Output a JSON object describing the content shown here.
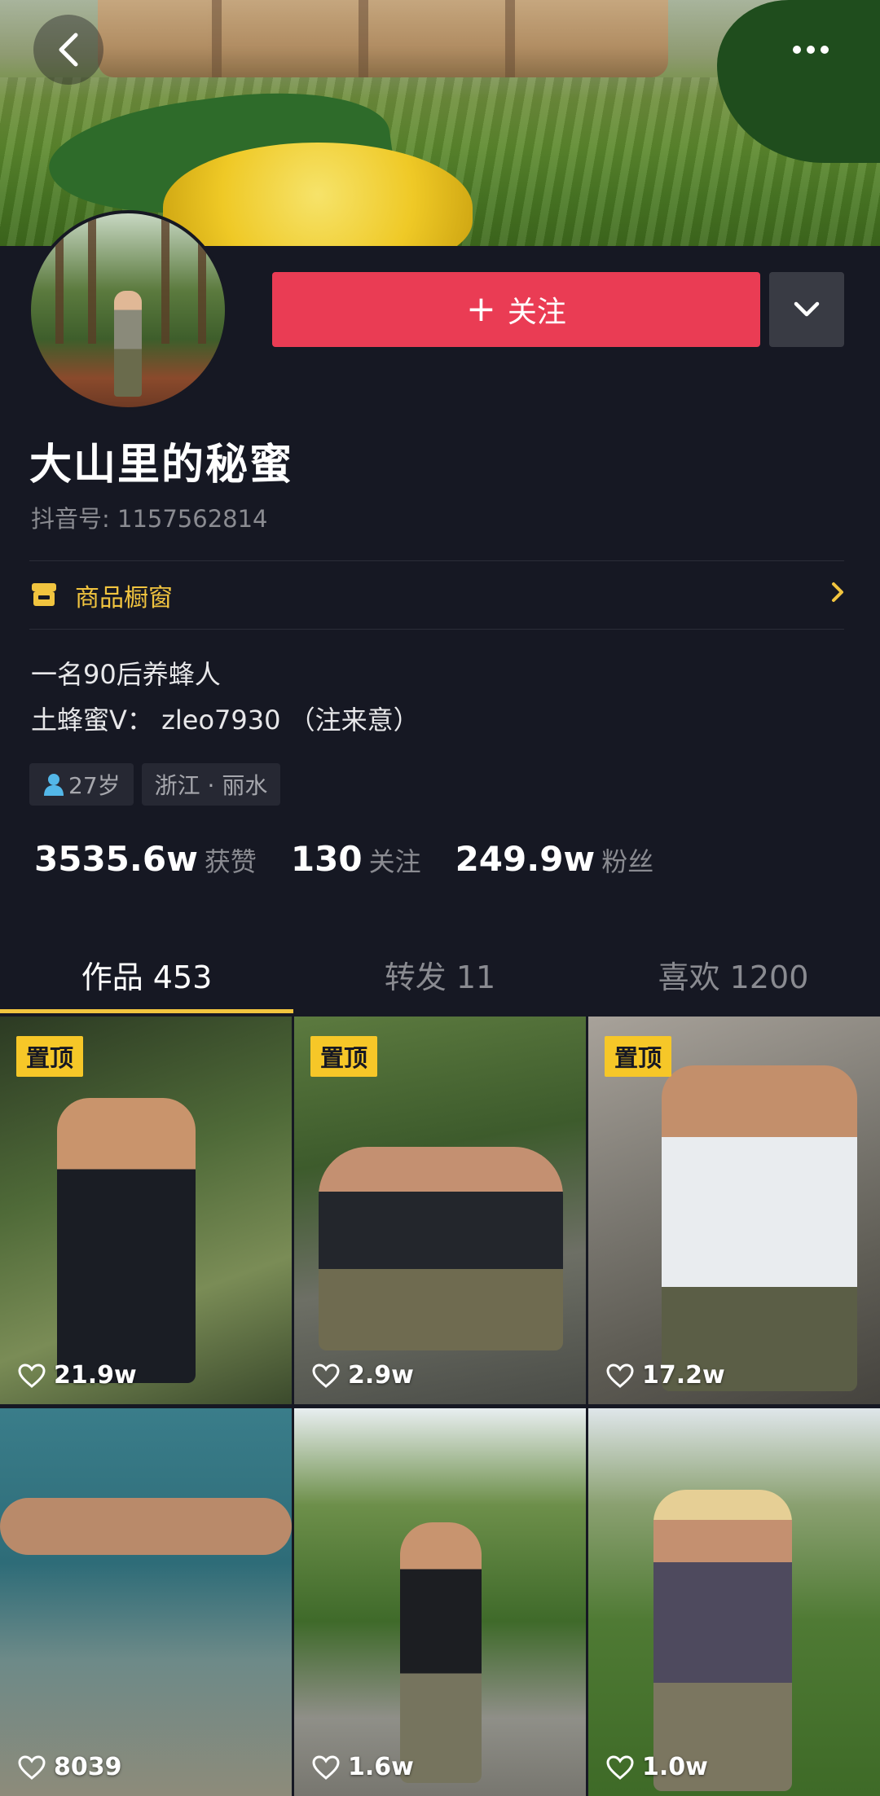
{
  "header": {
    "back_icon": "chevron-left-icon",
    "more_icon": "more-horizontal-icon"
  },
  "profile": {
    "follow_label": "关注",
    "name": "大山里的秘蜜",
    "douyin_id": "抖音号: 1157562814",
    "shop_label": "商品橱窗",
    "bio_line1": "一名90后养蜂人",
    "bio_line2": "土蜂蜜V：  zleo7930  （注来意）",
    "tags": [
      "27岁",
      "浙江 · 丽水"
    ]
  },
  "stats": {
    "likes_value": "3535.6w",
    "likes_label": "获赞",
    "following_value": "130",
    "following_label": "关注",
    "followers_value": "249.9w",
    "followers_label": "粉丝"
  },
  "tabs": [
    {
      "label": "作品 453",
      "active": true
    },
    {
      "label": "转发 11",
      "active": false
    },
    {
      "label": "喜欢 1200",
      "active": false
    }
  ],
  "videos": [
    {
      "pinned": true,
      "pin_label": "置顶",
      "likes": "21.9w"
    },
    {
      "pinned": true,
      "pin_label": "置顶",
      "likes": "2.9w"
    },
    {
      "pinned": true,
      "pin_label": "置顶",
      "likes": "17.2w"
    },
    {
      "pinned": false,
      "likes": "8039"
    },
    {
      "pinned": false,
      "likes": "1.6w"
    },
    {
      "pinned": false,
      "likes": "1.0w"
    }
  ],
  "colors": {
    "background": "#161823",
    "follow_button": "#ea3c54",
    "accent_yellow": "#f1c43f",
    "pin_badge": "#f6c728"
  }
}
